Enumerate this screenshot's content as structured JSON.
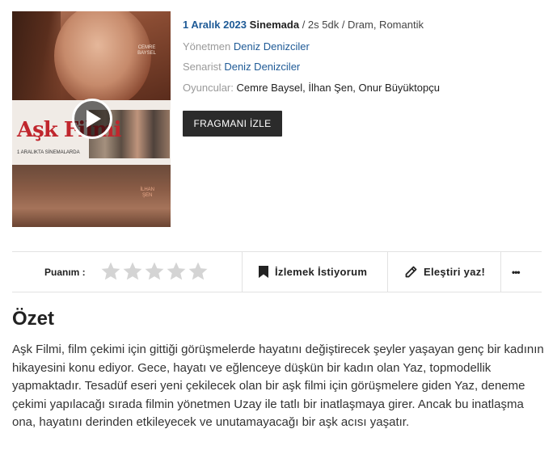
{
  "poster": {
    "title_art": "Aşk Filmi",
    "actor_top": "CEMRE\nBAYSEL",
    "actor_bottom": "İLHAN\nŞEN",
    "tag": "1 ARALIKTA SİNEMALARDA"
  },
  "meta": {
    "date": "1 Aralık 2023",
    "place": "Sinemada",
    "rest": " / 2s 5dk / Dram, Romantik",
    "director_label": "Yönetmen",
    "director": "Deniz Denizciler",
    "writer_label": "Senarist",
    "writer": "Deniz Denizciler",
    "cast_label": "Oyuncular:",
    "cast": "Cemre Baysel, İlhan Şen, Onur Büyüktopçu"
  },
  "trailer_button": "FRAGMANI İZLE",
  "actionbar": {
    "rating_label": "Puanım :",
    "stars_total": 5,
    "stars_filled": 0,
    "watch_label": "İzlemek İstiyorum",
    "review_label": "Eleştiri yaz!",
    "more_label": "•••"
  },
  "summary": {
    "title": "Özet",
    "text": "Aşk Filmi, film çekimi için gittiği görüşmelerde hayatını değiştirecek şeyler yaşayan genç bir kadının hikayesini konu ediyor. Gece, hayatı ve eğlenceye düşkün bir kadın olan Yaz, topmodellik yapmaktadır. Tesadüf eseri yeni çekilecek olan bir aşk filmi için görüşmelere giden Yaz, deneme çekimi yapılacağı sırada filmin yönetmen Uzay ile tatlı bir inatlaşmaya girer. Ancak bu inatlaşma ona, hayatını derinden etkileyecek ve unutamayacağı bir aşk acısı yaşatır."
  },
  "colors": {
    "link": "#1e5a96",
    "button_bg": "#2b2b2b",
    "star_empty": "#d4d4d4"
  }
}
